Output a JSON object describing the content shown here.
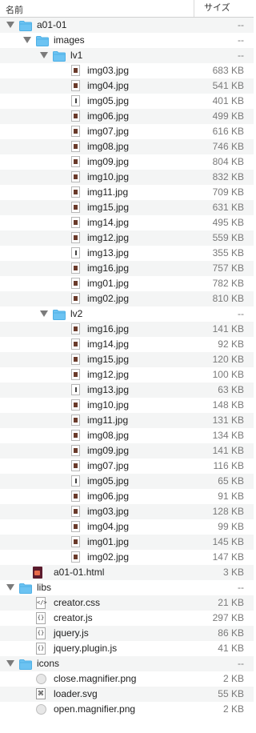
{
  "header": {
    "name_col": "名前",
    "size_col": "サイズ"
  },
  "rows": [
    {
      "name": "a01-01",
      "size": "--",
      "depth": 0,
      "kind": "folder",
      "open": true
    },
    {
      "name": "images",
      "size": "--",
      "depth": 1,
      "kind": "folder",
      "open": true
    },
    {
      "name": "lv1",
      "size": "--",
      "depth": 2,
      "kind": "folder",
      "open": true
    },
    {
      "name": "img03.jpg",
      "size": "683 KB",
      "depth": 3,
      "kind": "jpg"
    },
    {
      "name": "img04.jpg",
      "size": "541 KB",
      "depth": 3,
      "kind": "jpg"
    },
    {
      "name": "img05.jpg",
      "size": "401 KB",
      "depth": 3,
      "kind": "jpg-narrow"
    },
    {
      "name": "img06.jpg",
      "size": "499 KB",
      "depth": 3,
      "kind": "jpg"
    },
    {
      "name": "img07.jpg",
      "size": "616 KB",
      "depth": 3,
      "kind": "jpg"
    },
    {
      "name": "img08.jpg",
      "size": "746 KB",
      "depth": 3,
      "kind": "jpg"
    },
    {
      "name": "img09.jpg",
      "size": "804 KB",
      "depth": 3,
      "kind": "jpg"
    },
    {
      "name": "img10.jpg",
      "size": "832 KB",
      "depth": 3,
      "kind": "jpg"
    },
    {
      "name": "img11.jpg",
      "size": "709 KB",
      "depth": 3,
      "kind": "jpg"
    },
    {
      "name": "img15.jpg",
      "size": "631 KB",
      "depth": 3,
      "kind": "jpg"
    },
    {
      "name": "img14.jpg",
      "size": "495 KB",
      "depth": 3,
      "kind": "jpg"
    },
    {
      "name": "img12.jpg",
      "size": "559 KB",
      "depth": 3,
      "kind": "jpg"
    },
    {
      "name": "img13.jpg",
      "size": "355 KB",
      "depth": 3,
      "kind": "jpg-narrow"
    },
    {
      "name": "img16.jpg",
      "size": "757 KB",
      "depth": 3,
      "kind": "jpg"
    },
    {
      "name": "img01.jpg",
      "size": "782 KB",
      "depth": 3,
      "kind": "jpg"
    },
    {
      "name": "img02.jpg",
      "size": "810 KB",
      "depth": 3,
      "kind": "jpg"
    },
    {
      "name": "lv2",
      "size": "--",
      "depth": 2,
      "kind": "folder",
      "open": true
    },
    {
      "name": "img16.jpg",
      "size": "141 KB",
      "depth": 3,
      "kind": "jpg"
    },
    {
      "name": "img14.jpg",
      "size": "92 KB",
      "depth": 3,
      "kind": "jpg"
    },
    {
      "name": "img15.jpg",
      "size": "120 KB",
      "depth": 3,
      "kind": "jpg"
    },
    {
      "name": "img12.jpg",
      "size": "100 KB",
      "depth": 3,
      "kind": "jpg"
    },
    {
      "name": "img13.jpg",
      "size": "63 KB",
      "depth": 3,
      "kind": "jpg-narrow"
    },
    {
      "name": "img10.jpg",
      "size": "148 KB",
      "depth": 3,
      "kind": "jpg"
    },
    {
      "name": "img11.jpg",
      "size": "131 KB",
      "depth": 3,
      "kind": "jpg"
    },
    {
      "name": "img08.jpg",
      "size": "134 KB",
      "depth": 3,
      "kind": "jpg"
    },
    {
      "name": "img09.jpg",
      "size": "141 KB",
      "depth": 3,
      "kind": "jpg"
    },
    {
      "name": "img07.jpg",
      "size": "116 KB",
      "depth": 3,
      "kind": "jpg"
    },
    {
      "name": "img05.jpg",
      "size": "65 KB",
      "depth": 3,
      "kind": "jpg-narrow"
    },
    {
      "name": "img06.jpg",
      "size": "91 KB",
      "depth": 3,
      "kind": "jpg"
    },
    {
      "name": "img03.jpg",
      "size": "128 KB",
      "depth": 3,
      "kind": "jpg"
    },
    {
      "name": "img04.jpg",
      "size": "99 KB",
      "depth": 3,
      "kind": "jpg"
    },
    {
      "name": "img01.jpg",
      "size": "145 KB",
      "depth": 3,
      "kind": "jpg"
    },
    {
      "name": "img02.jpg",
      "size": "147 KB",
      "depth": 3,
      "kind": "jpg"
    },
    {
      "name": "a01-01.html",
      "size": "3 KB",
      "depth": 1,
      "kind": "html"
    },
    {
      "name": "libs",
      "size": "--",
      "depth": 0,
      "kind": "folder",
      "open": true
    },
    {
      "name": "creator.css",
      "size": "21 KB",
      "depth": 1,
      "kind": "css"
    },
    {
      "name": "creator.js",
      "size": "297 KB",
      "depth": 1,
      "kind": "js"
    },
    {
      "name": "jquery.js",
      "size": "86 KB",
      "depth": 1,
      "kind": "js"
    },
    {
      "name": "jquery.plugin.js",
      "size": "41 KB",
      "depth": 1,
      "kind": "js"
    },
    {
      "name": "icons",
      "size": "--",
      "depth": 0,
      "kind": "folder",
      "open": true
    },
    {
      "name": "close.magnifier.png",
      "size": "2 KB",
      "depth": 1,
      "kind": "png"
    },
    {
      "name": "loader.svg",
      "size": "55 KB",
      "depth": 1,
      "kind": "svg"
    },
    {
      "name": "open.magnifier.png",
      "size": "2 KB",
      "depth": 1,
      "kind": "png"
    }
  ],
  "colors": {
    "folder": "#6cc3f2",
    "folder_tab": "#4fb0e6",
    "row_alt": "#f4f5f5",
    "size_text": "#7a7a7a"
  },
  "icons": {
    "folder": "folder-icon",
    "jpg": "image-file-icon",
    "html": "html-file-icon",
    "css": "css-file-icon",
    "js": "js-file-icon",
    "png": "png-file-icon",
    "svg": "svg-file-icon",
    "disclosure": "disclosure-triangle-icon"
  }
}
